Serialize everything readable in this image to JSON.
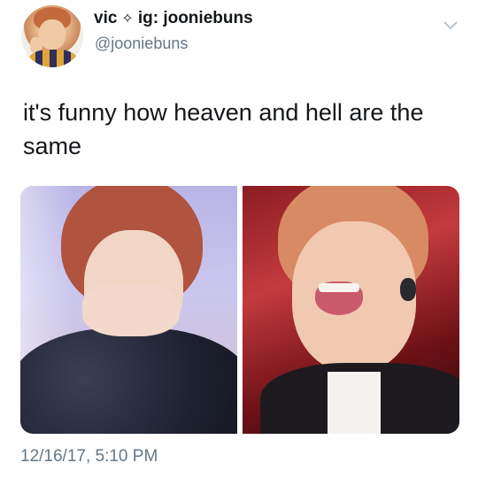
{
  "author": {
    "display_name": "vic",
    "separator_glyph": "✧",
    "display_name_suffix": "ig: jooniebuns",
    "handle": "@jooniebuns"
  },
  "tweet": {
    "text": "it's funny how heaven and hell are the same",
    "timestamp": "12/16/17, 5:10 PM"
  },
  "media": {
    "image_count": 2
  },
  "icons": {
    "menu": "chevron-down-icon",
    "avatar": "avatar"
  },
  "colors": {
    "text_primary": "#14171a",
    "text_secondary": "#657786",
    "background": "#ffffff"
  }
}
